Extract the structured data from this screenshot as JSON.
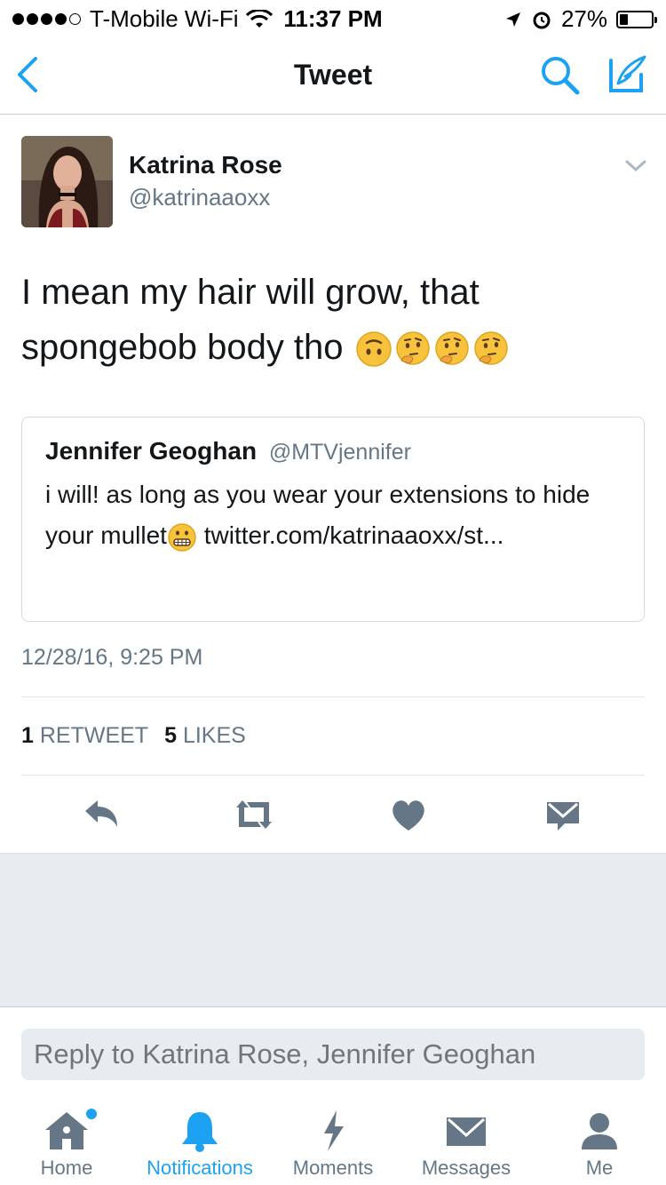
{
  "status_bar": {
    "carrier": "T-Mobile Wi-Fi",
    "time": "11:37 PM",
    "battery": "27%",
    "battery_level": 0.27
  },
  "nav": {
    "title": "Tweet",
    "back_icon": "chevron-left-icon",
    "search_icon": "search-icon",
    "compose_icon": "compose-icon"
  },
  "tweet": {
    "author_name": "Katrina Rose",
    "author_handle": "@katrinaaoxx",
    "text": "I mean my hair will grow, that spongebob body tho",
    "emojis": [
      "upside-down-face",
      "thinking-face",
      "thinking-face",
      "thinking-face"
    ],
    "timestamp": "12/28/16, 9:25 PM",
    "retweets_count": "1",
    "retweets_label": "RETWEET",
    "likes_count": "5",
    "likes_label": "LIKES"
  },
  "quoted_tweet": {
    "author_name": "Jennifer Geoghan",
    "author_handle": "@MTVjennifer",
    "text_part1": "i will! as long as you wear your extensions to hide your mullet",
    "emoji": "grimacing-face",
    "text_part2": " twitter.com/katrinaaoxx/st..."
  },
  "reply": {
    "placeholder": "Reply to Katrina Rose, Jennifer Geoghan"
  },
  "tabs": [
    {
      "label": "Home",
      "icon": "home-icon",
      "active": false
    },
    {
      "label": "Notifications",
      "icon": "bell-icon",
      "active": true
    },
    {
      "label": "Moments",
      "icon": "lightning-icon",
      "active": false
    },
    {
      "label": "Messages",
      "icon": "envelope-icon",
      "active": false
    },
    {
      "label": "Me",
      "icon": "person-icon",
      "active": false
    }
  ],
  "colors": {
    "accent": "#1da1f2",
    "text_primary": "#14171a",
    "text_secondary": "#657786",
    "gray_bg": "#e6ecf0"
  }
}
